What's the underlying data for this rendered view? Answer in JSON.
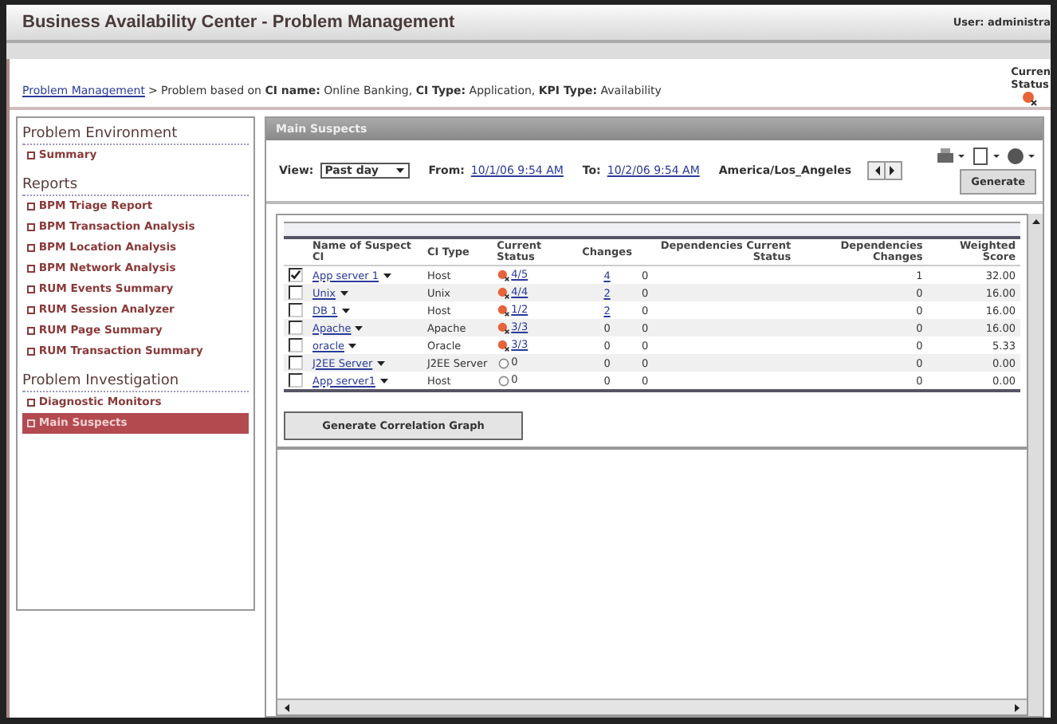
{
  "header": {
    "title": "Business Availability Center - Problem Management",
    "user": "User: administra"
  },
  "breadcrumb": {
    "link": "Problem Management",
    "text": "> Problem based on **CI name:** Online Banking, **CI Type:** Application, **KPI Type:** Availability"
  },
  "current_status": {
    "label_1": "Curren",
    "label_2": "Status",
    "alert": true
  },
  "sidebar": [
    {
      "title": "Problem Environment",
      "items": [
        {
          "label": "Summary",
          "selected": false
        }
      ]
    },
    {
      "title": "Reports",
      "items": [
        {
          "label": "BPM Triage Report",
          "selected": false
        },
        {
          "label": "BPM Transaction Analysis",
          "selected": false
        },
        {
          "label": "BPM Location Analysis",
          "selected": false
        },
        {
          "label": "BPM Network Analysis",
          "selected": false
        },
        {
          "label": "RUM Events Summary",
          "selected": false
        },
        {
          "label": "RUM Session Analyzer",
          "selected": false
        },
        {
          "label": "RUM Page Summary",
          "selected": false
        },
        {
          "label": "RUM Transaction Summary",
          "selected": false
        }
      ]
    },
    {
      "title": "Problem Investigation",
      "items": [
        {
          "label": "Diagnostic Monitors",
          "selected": false
        },
        {
          "label": "Main Suspects",
          "selected": true
        }
      ]
    }
  ],
  "panel": {
    "title": "Main Suspects",
    "view_label": "View:",
    "view_value": "Past day",
    "from_label": "From:",
    "from_value": "10/1/06 9:54 AM",
    "to_label": "To:",
    "to_value": "10/2/06 9:54 AM",
    "timezone": "America/Los_Angeles",
    "generate": "Generate"
  },
  "table": {
    "columns": [
      "Name of Suspect CI",
      "CI Type",
      "Current Status",
      "Changes",
      "Dependencies Current Status",
      "Dependencies Changes",
      "Weighted Score"
    ],
    "rows": [
      {
        "checked": true,
        "name": "App server 1",
        "ci_type": "Host",
        "alert": true,
        "status": "4/5",
        "changes": "4",
        "changes_link": true,
        "dep_status": "0",
        "dep_changes": "1",
        "score": "32.00"
      },
      {
        "checked": false,
        "name": "Unix",
        "ci_type": "Unix",
        "alert": true,
        "status": "4/4",
        "changes": "2",
        "changes_link": true,
        "dep_status": "0",
        "dep_changes": "0",
        "score": "16.00"
      },
      {
        "checked": false,
        "name": "DB 1",
        "ci_type": "Host",
        "alert": true,
        "status": "1/2",
        "changes": "2",
        "changes_link": true,
        "dep_status": "0",
        "dep_changes": "0",
        "score": "16.00"
      },
      {
        "checked": false,
        "name": "Apache",
        "ci_type": "Apache",
        "alert": true,
        "status": "3/3",
        "changes": "0",
        "changes_link": false,
        "dep_status": "0",
        "dep_changes": "0",
        "score": "16.00"
      },
      {
        "checked": false,
        "name": "oracle",
        "ci_type": "Oracle",
        "alert": true,
        "status": "3/3",
        "changes": "0",
        "changes_link": false,
        "dep_status": "0",
        "dep_changes": "0",
        "score": "5.33"
      },
      {
        "checked": false,
        "name": "J2EE Server",
        "ci_type": "J2EE Server",
        "alert": false,
        "status": "0",
        "changes": "0",
        "changes_link": false,
        "dep_status": "0",
        "dep_changes": "0",
        "score": "0.00"
      },
      {
        "checked": false,
        "name": "App server1",
        "ci_type": "Host",
        "alert": false,
        "status": "0",
        "changes": "0",
        "changes_link": false,
        "dep_status": "0",
        "dep_changes": "0",
        "score": "0.00"
      }
    ]
  },
  "correlation_button": "Generate Correlation Graph"
}
